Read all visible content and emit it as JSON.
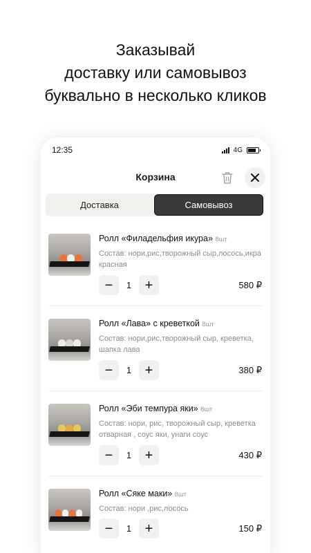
{
  "headline": [
    "Заказывай",
    "доставку или самовывоз",
    "буквально в несколько кликов"
  ],
  "status_bar": {
    "time": "12:35",
    "network": "4G"
  },
  "nav": {
    "title": "Корзина",
    "trash_icon": "trash-icon",
    "close_icon": "close-icon"
  },
  "segments": [
    {
      "label": "Доставка",
      "active": false
    },
    {
      "label": "Самовывоз",
      "active": true
    }
  ],
  "cart_items": [
    {
      "name": "Ролл «Филадельфия икура»",
      "pieces": "8шт",
      "composition": "Состав: нори,рис,творожный сыр,лосось,икра красная",
      "quantity": "1",
      "price": "580 ₽"
    },
    {
      "name": "Ролл «Лава» с креветкой",
      "pieces": "8шт",
      "composition": "Состав: нори,рис,творожный сыр, креветка, шапка лава",
      "quantity": "1",
      "price": "380 ₽"
    },
    {
      "name": "Ролл «Эби темпура яки»",
      "pieces": "8шт",
      "composition": "Состав: нори, рис, творожный сыр, креветка отварная , соус яки, унаги соус",
      "quantity": "1",
      "price": "430 ₽"
    },
    {
      "name": "Ролл «Сяке маки»",
      "pieces": "8шт",
      "composition": "Состав: нори ,рис,лосось",
      "quantity": "1",
      "price": "150 ₽"
    }
  ],
  "stepper": {
    "minus": "−",
    "plus": "+"
  },
  "colors": {
    "active_segment": "#3a3a3a",
    "segment_bg": "#f2f1ee",
    "stepper_bg": "#f1f1ef"
  }
}
